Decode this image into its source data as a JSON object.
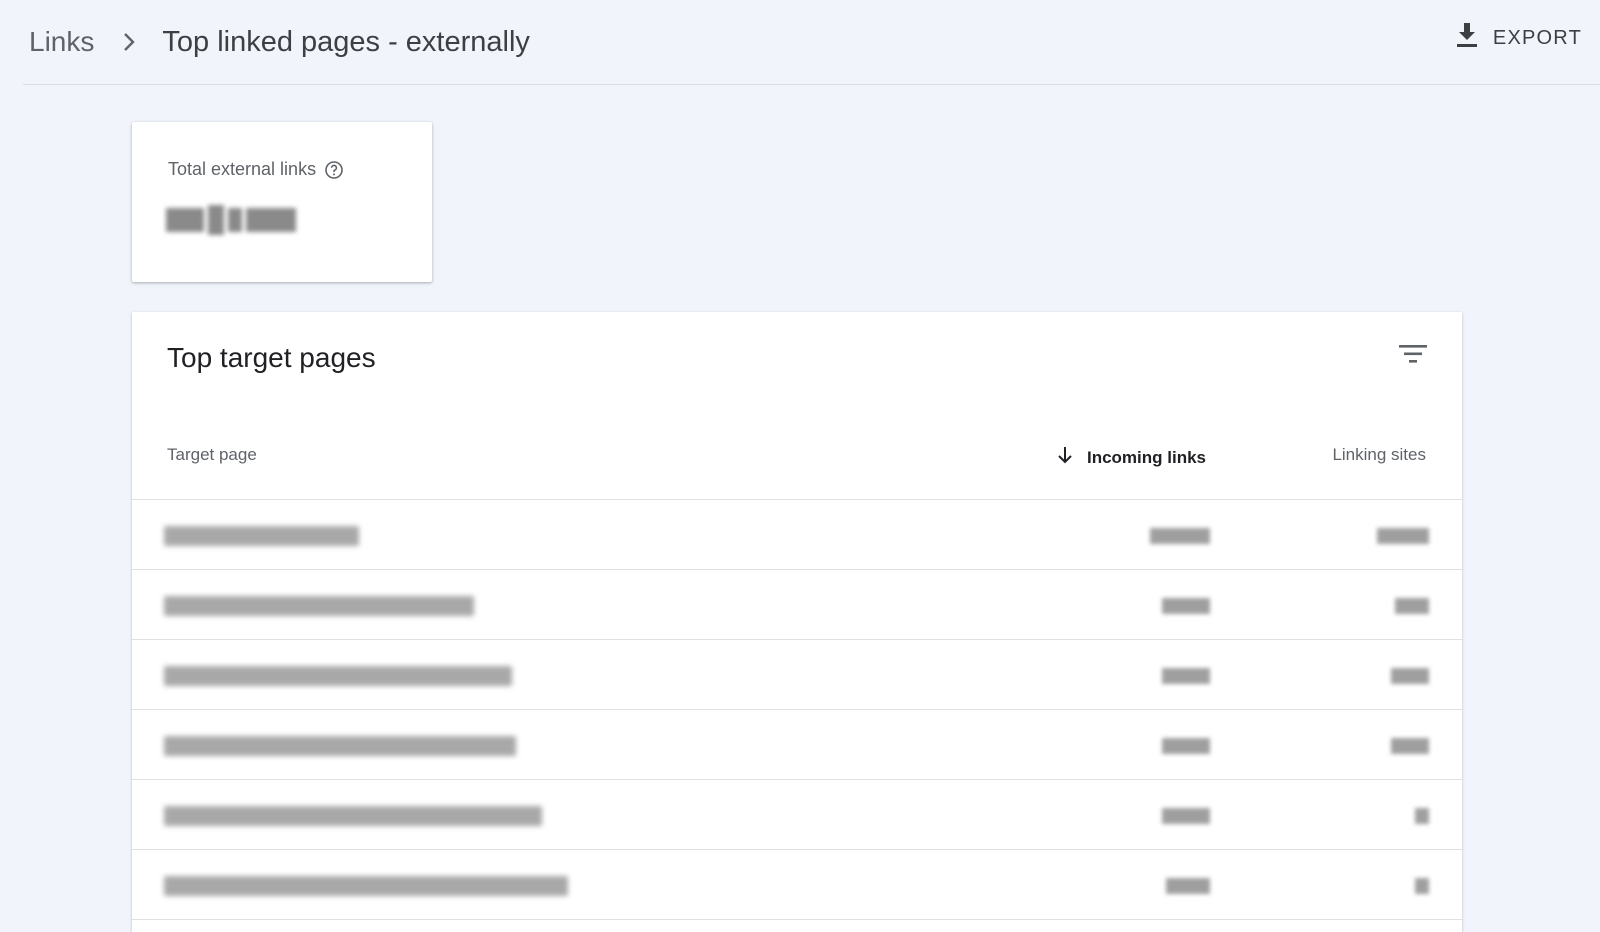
{
  "header": {
    "breadcrumb_parent": "Links",
    "title": "Top linked pages - externally",
    "export_label": "EXPORT",
    "icons": {
      "separator": "chevron-right-icon",
      "export": "download-icon"
    }
  },
  "summary_card": {
    "label": "Total external links",
    "help_icon": "help-circle-icon",
    "value_state": "redacted"
  },
  "table": {
    "title": "Top target pages",
    "filter_icon": "filter-icon",
    "columns": [
      "Target page",
      "Incoming links",
      "Linking sites"
    ],
    "sort_column": "Incoming links",
    "sort_direction": "descending",
    "row_count_visible": 6,
    "row_values_state": "redacted"
  },
  "colors": {
    "background": "#f1f4fb",
    "card": "#ffffff",
    "text_primary": "#202124",
    "text_secondary": "#5f6368"
  }
}
